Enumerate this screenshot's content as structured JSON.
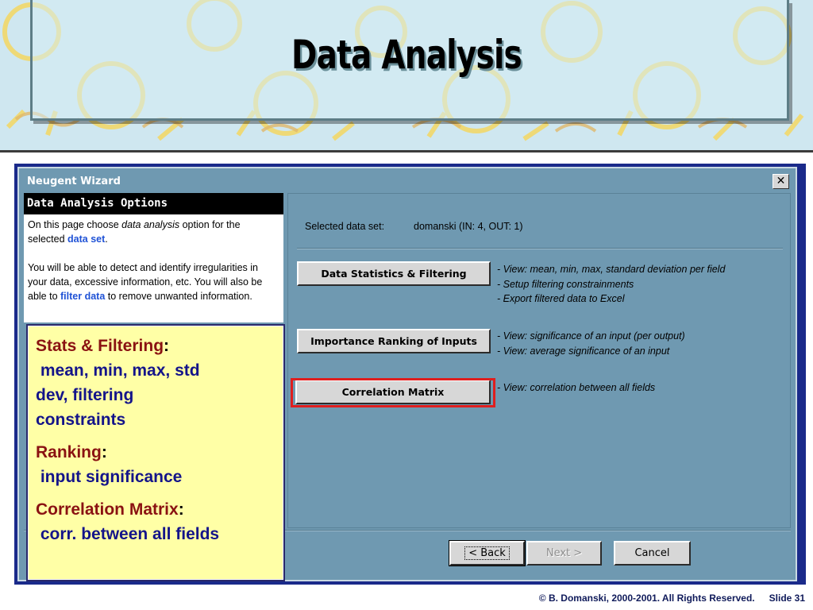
{
  "slide": {
    "title": "Data Analysis",
    "footer_copyright": "© B. Domanski, 2000-2001.  All Rights Reserved.",
    "footer_slide": "Slide 31"
  },
  "window": {
    "title": "Neugent Wizard",
    "close_glyph": "✕"
  },
  "info_panel": {
    "heading": "Data Analysis Options",
    "p1_pre": "On this page choose ",
    "p1_em": "data analysis",
    "p1_mid": " option for the selected ",
    "p1_kw": "data set",
    "p1_post": ".",
    "p2_pre": "You will be able to detect and identify irregularities in your data, excessive information, etc. You will also be able to ",
    "p2_kw": "filter data",
    "p2_post": " to remove unwanted information."
  },
  "selected": {
    "label": "Selected data set:",
    "value": "domanski (IN: 4, OUT: 1)"
  },
  "options": [
    {
      "button": "Data Statistics & Filtering",
      "lines": [
        "- View: mean, min, max, standard deviation per field",
        "- Setup filtering constrainments",
        "- Export filtered data to Excel"
      ]
    },
    {
      "button": "Importance Ranking of Inputs",
      "lines": [
        "- View: significance of an input (per output)",
        "- View: average significance of an input"
      ]
    },
    {
      "button": "Correlation Matrix",
      "lines": [
        "- View: correlation between all fields"
      ]
    }
  ],
  "nav": {
    "back": "< Back",
    "next": "Next >",
    "cancel": "Cancel"
  },
  "callout": {
    "items": [
      {
        "head": "Stats & Filtering",
        "text": " mean, min, max, std\ndev, filtering\nconstraints"
      },
      {
        "head": "Ranking",
        "text": " input significance"
      },
      {
        "head": "Correlation Matrix",
        "text": " corr. between all fields"
      }
    ],
    "colon": ":"
  },
  "colors": {
    "dialog_bg": "#6f99b1",
    "callout_bg": "#ffffa6",
    "highlight": "#e01e1e",
    "callout_head": "#8a1212",
    "callout_text": "#14148a"
  }
}
